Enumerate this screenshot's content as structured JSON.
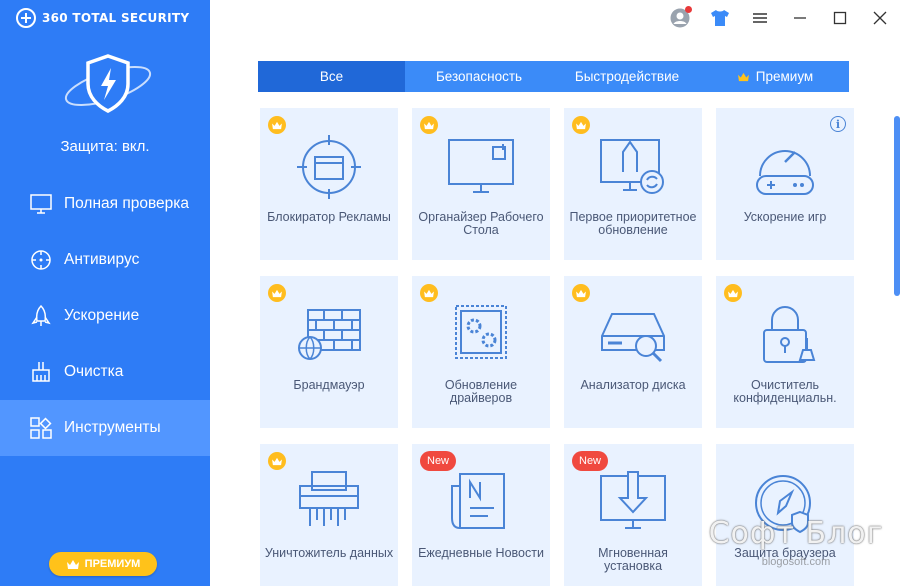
{
  "app": {
    "brand": "360 TOTAL SECURITY",
    "protection_status": "Защита: вкл.",
    "premium_button": "ПРЕМИУМ"
  },
  "sidebar": {
    "items": [
      {
        "label": "Полная проверка",
        "icon": "monitor-icon",
        "active": false
      },
      {
        "label": "Антивирус",
        "icon": "target-icon",
        "active": false
      },
      {
        "label": "Ускорение",
        "icon": "rocket-icon",
        "active": false
      },
      {
        "label": "Очистка",
        "icon": "broom-icon",
        "active": false
      },
      {
        "label": "Инструменты",
        "icon": "grid-icon",
        "active": true
      }
    ]
  },
  "tabs": [
    {
      "label": "Все",
      "active": true
    },
    {
      "label": "Безопасность",
      "active": false
    },
    {
      "label": "Быстродействие",
      "active": false
    },
    {
      "label": "Премиум",
      "active": false,
      "icon": "crown-icon"
    }
  ],
  "tools": [
    {
      "label": "Блокиратор Рекламы",
      "badge": "crown",
      "icon": "ad-blocker-icon"
    },
    {
      "label": "Органайзер Рабочего Стола",
      "badge": "crown",
      "icon": "desktop-organizer-icon"
    },
    {
      "label": "Первое приоритетное обновление",
      "badge": "crown",
      "icon": "priority-update-icon"
    },
    {
      "label": "Ускорение игр",
      "badge": "info",
      "icon": "gamepad-icon"
    },
    {
      "label": "Брандмауэр",
      "badge": "crown",
      "icon": "firewall-icon"
    },
    {
      "label": "Обновление драйверов",
      "badge": "crown",
      "icon": "driver-update-icon"
    },
    {
      "label": "Анализатор диска",
      "badge": "crown",
      "icon": "disk-analyzer-icon"
    },
    {
      "label": "Очиститель конфиденциальн.",
      "badge": "crown",
      "icon": "privacy-cleaner-icon"
    },
    {
      "label": "Уничтожитель данных",
      "badge": "crown",
      "icon": "shredder-icon"
    },
    {
      "label": "Ежедневные Новости",
      "badge": "New",
      "icon": "news-icon"
    },
    {
      "label": "Мгновенная установка",
      "badge": "New",
      "icon": "instant-install-icon"
    },
    {
      "label": "Защита браузера",
      "badge": "none",
      "icon": "browser-protection-icon"
    }
  ],
  "watermark": {
    "title": "Софт Блог",
    "url": "blogosoft.com"
  },
  "colors": {
    "sidebar": "#2e7cf6",
    "sidebar_active": "#5296ff",
    "tabs": "#3b8bf8",
    "tab_active": "#2068d8",
    "card": "#e9f2ff",
    "icon_stroke": "#4a84d6",
    "crown_badge": "#ffbd1f",
    "new_badge": "#f0493f",
    "premium": "#ffc21a"
  }
}
